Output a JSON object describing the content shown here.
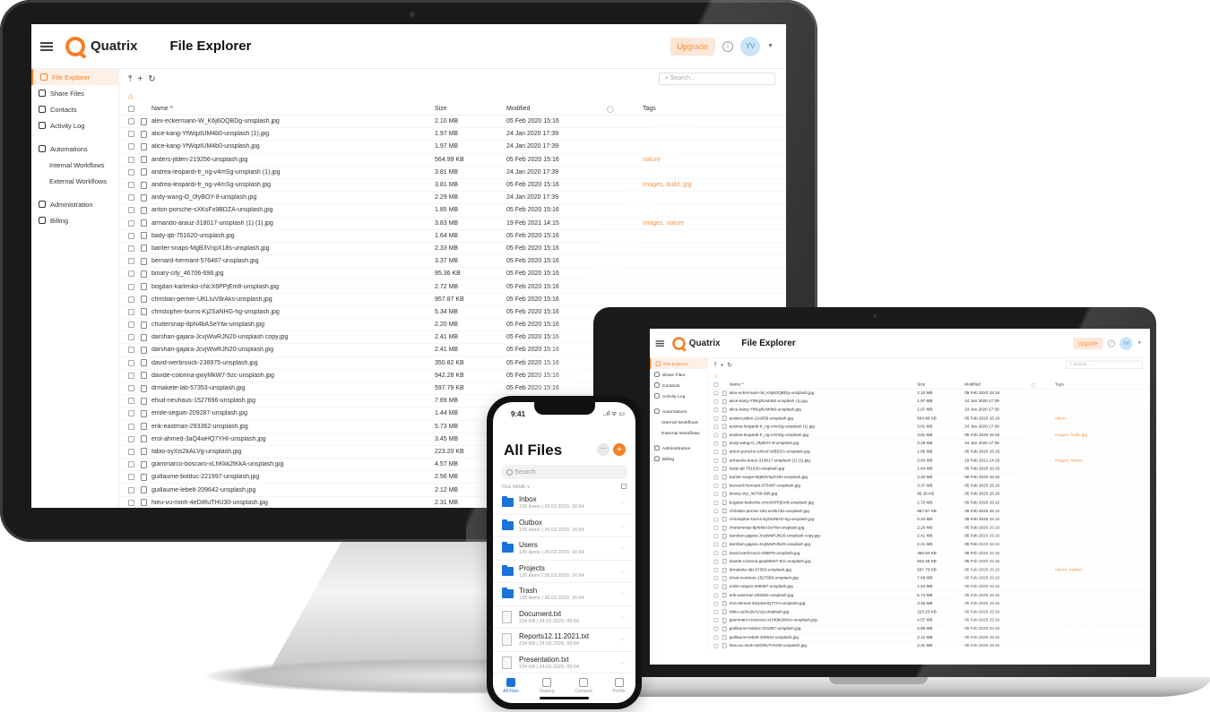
{
  "app": {
    "logo": "Quatrix",
    "page_title": "File Explorer",
    "upgrade_label": "Upgrade",
    "avatar_initials": "YV",
    "search_placeholder": "Search...",
    "accent_color": "#f58025"
  },
  "sidebar": {
    "items": [
      {
        "label": "File Explorer",
        "icon": "layers-icon",
        "active": true
      },
      {
        "label": "Share Files",
        "icon": "share-icon"
      },
      {
        "label": "Contacts",
        "icon": "contacts-icon"
      },
      {
        "label": "Activity Log",
        "icon": "log-icon"
      },
      {
        "label": "Automations",
        "icon": "automation-icon"
      },
      {
        "label": "Internal Workflows",
        "sub": true
      },
      {
        "label": "External Workflows",
        "sub": true
      },
      {
        "label": "Administration",
        "icon": "admin-icon"
      },
      {
        "label": "Billing",
        "icon": "billing-icon"
      }
    ]
  },
  "table": {
    "headers": {
      "name": "Name ^",
      "size": "Size",
      "modified": "Modified",
      "tags": "Tags"
    },
    "rows": [
      {
        "name": "alex-eckermann-W_K6j6OQBDg-unsplash.jpg",
        "size": "2.10 MB",
        "modified": "05 Feb 2020 15:16",
        "tags": ""
      },
      {
        "name": "alice-kang-YfWqzlUM4b0-unsplash (1).jpg",
        "size": "1.97 MB",
        "modified": "24 Jan 2020 17:39",
        "tags": ""
      },
      {
        "name": "alice-kang-YfWqzlUM4b0-unsplash.jpg",
        "size": "1.97 MB",
        "modified": "24 Jan 2020 17:39",
        "tags": ""
      },
      {
        "name": "anders-jilden-219256-unsplash.jpg",
        "size": "564.99 KB",
        "modified": "05 Feb 2020 15:16",
        "tags": "nature"
      },
      {
        "name": "andrea-leopardi-fr_ng-v4mSg-unsplash (1).jpg",
        "size": "3.81 MB",
        "modified": "24 Jan 2020 17:39",
        "tags": ""
      },
      {
        "name": "andrea-leopardi-fr_ng-v4mSg-unsplash.jpg",
        "size": "3.81 MB",
        "modified": "05 Feb 2020 15:16",
        "tags": "images, build, jpg"
      },
      {
        "name": "andy-wang-O_0fyBOY-8-unsplash.jpg",
        "size": "2.29 MB",
        "modified": "24 Jan 2020 17:39",
        "tags": ""
      },
      {
        "name": "anton-porsche-sXKsFx9BDZA-unsplash.jpg",
        "size": "1.85 MB",
        "modified": "05 Feb 2020 15:16",
        "tags": ""
      },
      {
        "name": "armando-arauz-318017-unsplash (1) (1).jpg",
        "size": "3.83 MB",
        "modified": "19 Feb 2021 14:15",
        "tags": "images, nature"
      },
      {
        "name": "bady-qb-751620-unsplash.jpg",
        "size": "1.64 MB",
        "modified": "05 Feb 2020 15:16",
        "tags": ""
      },
      {
        "name": "banter-snaps-MgB3VnpX18s-unsplash.jpg",
        "size": "2.33 MB",
        "modified": "05 Feb 2020 15:16",
        "tags": ""
      },
      {
        "name": "bernard-hermant-576487-unsplash.jpg",
        "size": "3.37 MB",
        "modified": "05 Feb 2020 15:16",
        "tags": ""
      },
      {
        "name": "binary-city_46706-696.jpg",
        "size": "95.36 KB",
        "modified": "05 Feb 2020 15:16",
        "tags": ""
      },
      {
        "name": "bogdan-karlenko-cNcX6PPjEm8-unsplash.jpg",
        "size": "2.72 MB",
        "modified": "05 Feb 2020 15:16",
        "tags": ""
      },
      {
        "name": "christian-perner-UKLIuV8rAks-unsplash.jpg",
        "size": "957.87 KB",
        "modified": "05 Feb 2020 15:16",
        "tags": ""
      },
      {
        "name": "christopher-burns-Kj2SaNHG-hg-unsplash.jpg",
        "size": "5.34 MB",
        "modified": "05 Feb 2020 15:16",
        "tags": ""
      },
      {
        "name": "chuttersnap-8pN4bASeYtw-unsplash.jpg",
        "size": "2.20 MB",
        "modified": "05 Feb 2020 15:16",
        "tags": ""
      },
      {
        "name": "darshan-gajara-JcvjWwRJN20-unsplash copy.jpg",
        "size": "2.41 MB",
        "modified": "05 Feb 2020 15:16",
        "tags": ""
      },
      {
        "name": "darshan-gajara-JcvjWwRJN20-unsplash.jpg",
        "size": "2.41 MB",
        "modified": "05 Feb 2020 15:16",
        "tags": ""
      },
      {
        "name": "david-werbrouck-238975-unsplash.jpg",
        "size": "350.82 KB",
        "modified": "05 Feb 2020 15:16",
        "tags": ""
      },
      {
        "name": "davide-colonna-gwyMkW7-9zc-unsplash.jpg",
        "size": "942.28 KB",
        "modified": "05 Feb 2020 15:16",
        "tags": ""
      },
      {
        "name": "drmakete-lab-57353-unsplash.jpg",
        "size": "597.79 KB",
        "modified": "05 Feb 2020 15:16",
        "tags": "nature, market"
      },
      {
        "name": "ehud-neuhaus-1527696-unsplash.jpg",
        "size": "7.69 MB",
        "modified": "05 Feb 2020 15:16",
        "tags": ""
      },
      {
        "name": "emile-seguin-209287-unsplash.jpg",
        "size": "1.44 MB",
        "modified": "05 Feb 2020 15:16",
        "tags": ""
      },
      {
        "name": "erik-eastman-293362-unsplash.jpg",
        "size": "5.73 MB",
        "modified": "05 Feb 2020 15:16",
        "tags": ""
      },
      {
        "name": "erol-ahmed-3aQ4wHQ7YHI-unsplash.jpg",
        "size": "3.45 MB",
        "modified": "05 Feb 2020 15:16",
        "tags": ""
      },
      {
        "name": "fabio-oyXis2kALVg-unsplash.jpg",
        "size": "223.20 KB",
        "modified": "05 Feb 2020 15:16",
        "tags": ""
      },
      {
        "name": "giammarco-boscaro-xLhKkk2tKkA-unsplash.jpg",
        "size": "4.57 MB",
        "modified": "05 Feb 2020 15:16",
        "tags": ""
      },
      {
        "name": "guillaume-bolduc-221997-unsplash.jpg",
        "size": "2.56 MB",
        "modified": "05 Feb 2020 15:16",
        "tags": ""
      },
      {
        "name": "guillaume-lebelt-209642-unsplash.jpg",
        "size": "2.12 MB",
        "modified": "05 Feb 2020 15:16",
        "tags": ""
      },
      {
        "name": "hieu-vu-minh-4eDiRuTHU30-unsplash.jpg",
        "size": "2.31 MB",
        "modified": "05 Feb 2020 15:16",
        "tags": ""
      }
    ]
  },
  "phone": {
    "time": "9:41",
    "status_icons": "..ıl ᯤ ▭",
    "title": "All Files",
    "search_placeholder": "Search",
    "sort_label": "FILE NAME ∨",
    "items": [
      {
        "type": "folder",
        "name": "Inbox",
        "meta": "135 items | 26.03.2020, 16:54"
      },
      {
        "type": "folder",
        "name": "Outbox",
        "meta": "135 items | 26.03.2020, 16:54"
      },
      {
        "type": "folder",
        "name": "Users",
        "meta": "135 items | 26.03.2020, 16:54"
      },
      {
        "type": "folder",
        "name": "Projects",
        "meta": "135 items | 26.03.2020, 16:54"
      },
      {
        "type": "folder",
        "name": "Trash",
        "meta": "135 items | 26.03.2020, 16:54"
      },
      {
        "type": "file",
        "name": "Document.txt",
        "meta": "234 KB | 24.03.2020, 09:54"
      },
      {
        "type": "file",
        "name": "Reports12.11.2021.txt",
        "meta": "234 KB | 24.03.2020, 09:54"
      },
      {
        "type": "file",
        "name": "Presentation.txt",
        "meta": "234 KB | 24.03.2020, 09:54"
      }
    ],
    "tabs": [
      "All Files",
      "Sharing",
      "Contacts",
      "Profile"
    ]
  }
}
